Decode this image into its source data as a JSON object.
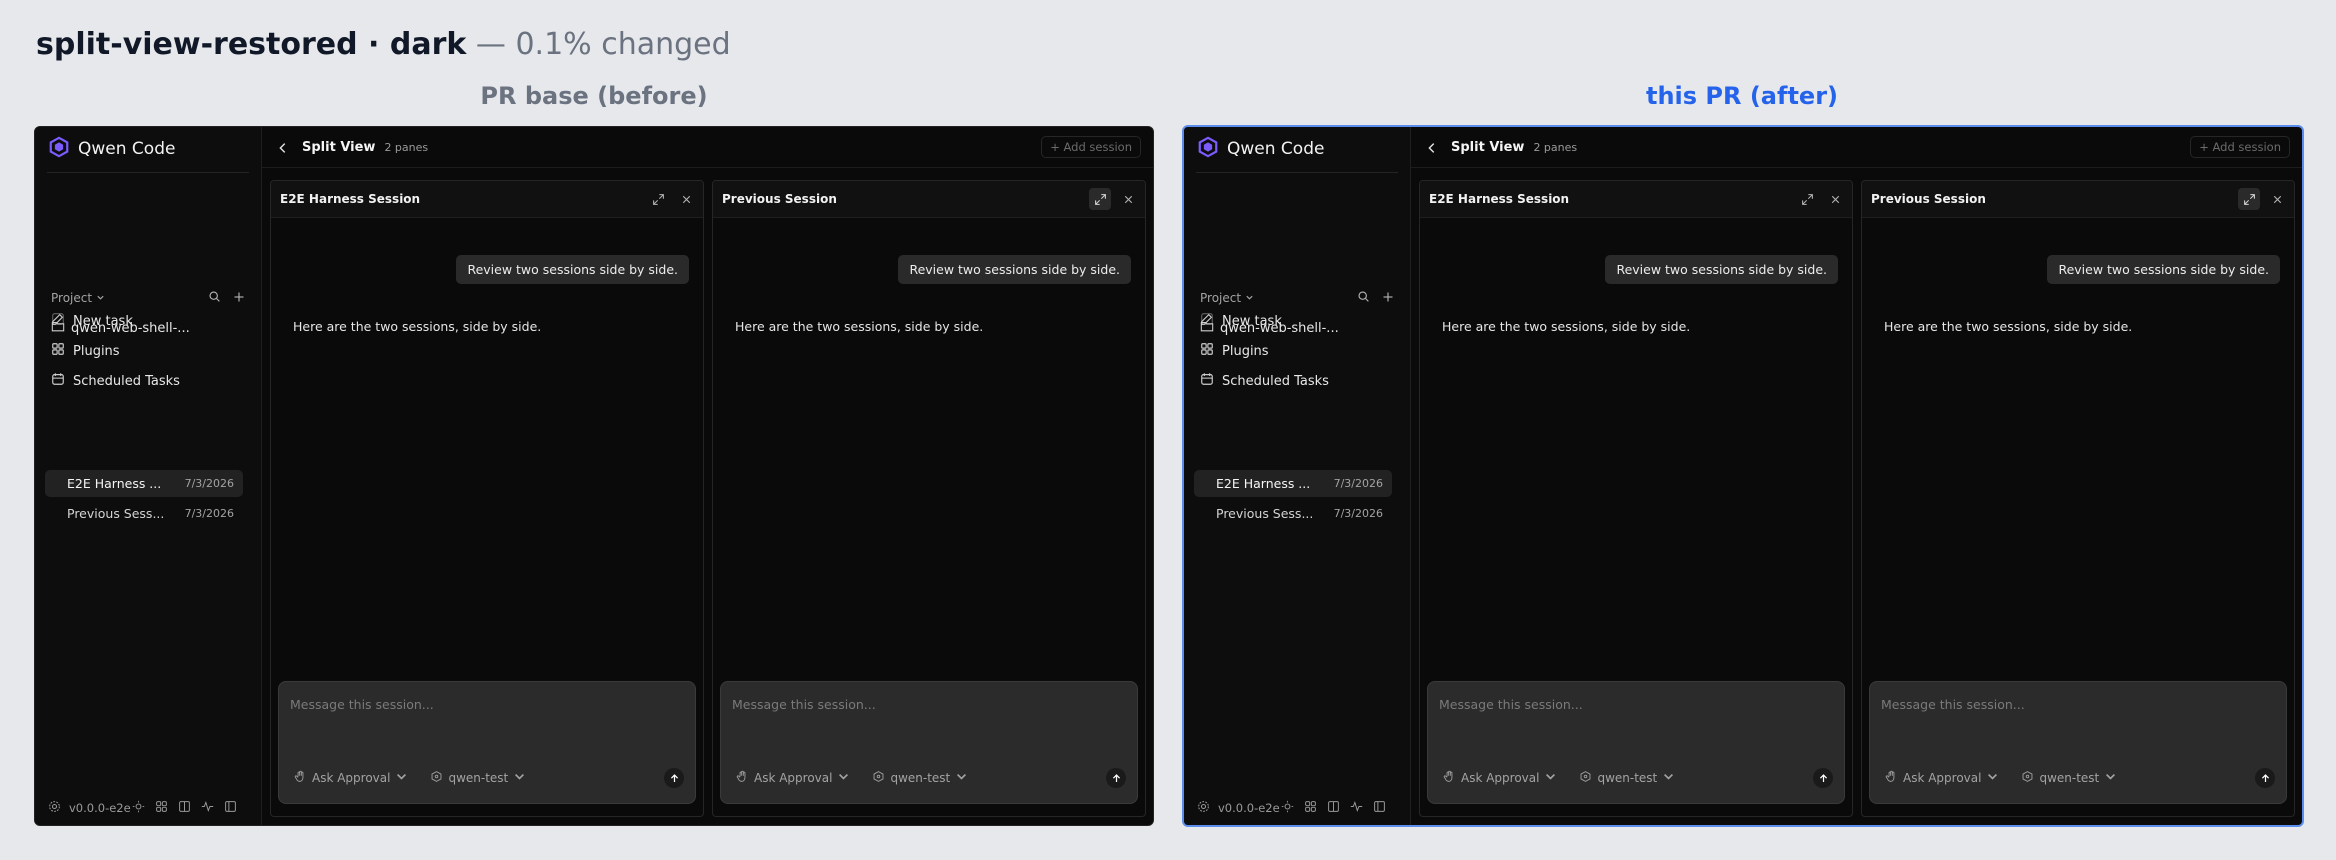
{
  "heading": {
    "name": "split-view-restored · dark",
    "diff": "— 0.1% changed"
  },
  "labels": {
    "before": "PR base (before)",
    "after": "this PR (after)"
  },
  "app": {
    "name": "Qwen Code",
    "nav": [
      {
        "label": "New task",
        "icon": "edit-icon"
      },
      {
        "label": "Plugins",
        "icon": "plugin-icon"
      },
      {
        "label": "Scheduled Tasks",
        "icon": "calendar-icon"
      }
    ],
    "project_label": "Project",
    "folder": "qwen-web-shell-...",
    "sessions": [
      {
        "name": "E2E Harness ...",
        "date": "7/3/2026",
        "active": true
      },
      {
        "name": "Previous Sess...",
        "date": "7/3/2026",
        "active": false
      }
    ],
    "version": "v0.0.0-e2e",
    "topbar": {
      "title": "Split View",
      "pane_count": "2 panes",
      "add_session": "+ Add session"
    },
    "panes": [
      {
        "title": "E2E Harness Session",
        "user_message": "Review two sessions side by side.",
        "assistant_message": "Here are the two sessions, side by side.",
        "composer_placeholder": "Message this session...",
        "approval": "Ask Approval",
        "model": "qwen-test"
      },
      {
        "title": "Previous Session",
        "user_message": "Review two sessions side by side.",
        "assistant_message": "Here are the two sessions, side by side.",
        "composer_placeholder": "Message this session...",
        "approval": "Ask Approval",
        "model": "qwen-test"
      }
    ]
  },
  "colors": {
    "background": "#e6e8ec",
    "app_bg": "#0a0a0a",
    "accent_after": "#2563eb",
    "logo": "#7c5cff"
  }
}
